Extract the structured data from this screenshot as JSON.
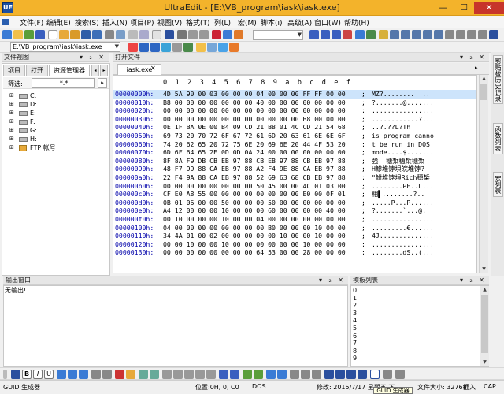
{
  "window": {
    "title": "UltraEdit - [E:\\VB_program\\iask\\iask.exe]",
    "app_icon": "UE",
    "minimize": "—",
    "maximize": "☐",
    "close": "✕"
  },
  "menu": [
    "文件(F)",
    "编辑(E)",
    "搜索(S)",
    "插入(N)",
    "项目(P)",
    "视图(V)",
    "格式(T)",
    "列(L)",
    "宏(M)",
    "脚本(i)",
    "高级(A)",
    "窗口(W)",
    "帮助(H)"
  ],
  "toolbar": {
    "path_combo": "E:\\VB_program\\iask\\iask.exe",
    "search_combo": ""
  },
  "file_view": {
    "title": "文件视图",
    "tabs": [
      "项目",
      "打开",
      "资源管理器"
    ],
    "filter_label": "筛选:",
    "filter_value": "*.*",
    "drives": [
      "C:",
      "D:",
      "E:",
      "F:",
      "G:",
      "H:",
      "FTP 帐号"
    ]
  },
  "open_files": {
    "title": "打开文件",
    "tab": "iask.exe"
  },
  "hex": {
    "header": "0  1  2  3  4  5  6  7  8  9  a  b  c  d  e  f",
    "rows": [
      {
        "addr": "00000000h:",
        "bytes": "4D 5A 90 00 03 00 00 00 04 00 00 00 FF FF 00 00",
        "ascii": "MZ?........  .."
      },
      {
        "addr": "00000010h:",
        "bytes": "B8 00 00 00 00 00 00 00 40 00 00 00 00 00 00 00",
        "ascii": "?.......@......."
      },
      {
        "addr": "00000020h:",
        "bytes": "00 00 00 00 00 00 00 00 00 00 00 00 00 00 00 00",
        "ascii": "................"
      },
      {
        "addr": "00000030h:",
        "bytes": "00 00 00 00 00 00 00 00 00 00 00 00 B8 00 00 00",
        "ascii": "............?..."
      },
      {
        "addr": "00000040h:",
        "bytes": "0E 1F BA 0E 00 B4 09 CD 21 B8 01 4C CD 21 54 68",
        "ascii": "..?.??L?Th"
      },
      {
        "addr": "00000050h:",
        "bytes": "69 73 20 70 72 6F 67 72 61 6D 20 63 61 6E 6E 6F",
        "ascii": "is program canno"
      },
      {
        "addr": "00000060h:",
        "bytes": "74 20 62 65 20 72 75 6E 20 69 6E 20 44 4F 53 20",
        "ascii": "t be run in DOS "
      },
      {
        "addr": "00000070h:",
        "bytes": "6D 6F 64 65 2E 0D 0D 0A 24 00 00 00 00 00 00 00",
        "ascii": "mode....$......."
      },
      {
        "addr": "00000080h:",
        "bytes": "8F 8A F9 DB CB EB 97 88 CB EB 97 88 CB EB 97 88",
        "ascii": "強  穗椞穗椞穗椞"
      },
      {
        "addr": "00000090h:",
        "bytes": "48 F7 99 88 CA EB 97 88 A2 F4 9E 88 CA EB 97 88",
        "ascii": "H鯵堆饽垻皖堆饽?"
      },
      {
        "addr": "000000a0h:",
        "bytes": "22 F4 9A 88 CA EB 97 88 52 69 63 68 CB EB 97 88",
        "ascii": "\"鮒堆饽垻Rich穗椞"
      },
      {
        "addr": "000000b0h:",
        "bytes": "00 00 00 00 00 00 00 00 50 45 00 00 4C 01 03 00",
        "ascii": "........PE..L..."
      },
      {
        "addr": "000000c0h:",
        "bytes": "CF E0 A8 55 00 00 00 00 00 00 00 00 E0 00 0F 01",
        "ascii": "相▌........?.."
      },
      {
        "addr": "000000d0h:",
        "bytes": "0B 01 06 00 00 50 00 00 00 50 00 00 00 00 00 00",
        "ascii": ".....P...P......"
      },
      {
        "addr": "000000e0h:",
        "bytes": "A4 12 00 00 00 10 00 00 00 60 00 00 00 00 40 00",
        "ascii": "?.......`...@."
      },
      {
        "addr": "000000f0h:",
        "bytes": "00 10 00 00 00 10 00 00 04 00 00 00 00 00 00 00",
        "ascii": "................"
      },
      {
        "addr": "00000100h:",
        "bytes": "04 00 00 00 00 00 00 00 00 B0 00 00 00 10 00 00",
        "ascii": ".........€......"
      },
      {
        "addr": "00000110h:",
        "bytes": "34 4A 01 00 02 00 00 00 00 00 10 00 00 10 00 00",
        "ascii": "4J.............."
      },
      {
        "addr": "00000120h:",
        "bytes": "00 00 10 00 00 10 00 00 00 00 00 00 10 00 00 00",
        "ascii": "................"
      },
      {
        "addr": "00000130h:",
        "bytes": "00 00 00 00 00 00 00 00 64 53 00 00 28 00 00 00",
        "ascii": "........dS..(..."
      }
    ]
  },
  "right_tabs": [
    "剪贴板历史记录",
    "函数列表",
    "宏列表"
  ],
  "output": {
    "title": "输出窗口",
    "text": "无输出!"
  },
  "template": {
    "title": "模板列表",
    "items": [
      "0",
      "1",
      "2",
      "3",
      "4",
      "5",
      "6",
      "7",
      "8",
      "9"
    ]
  },
  "status": {
    "guid": "GUID 生成器",
    "position": "位置:0H, 0, C0",
    "dos": "DOS",
    "modified": "修改: 2015/7/17 星期五 下...",
    "filesize": "文件大小: 32768",
    "ins": "插入",
    "cap": "CAP",
    "tooltip": "GUID 生成器"
  }
}
